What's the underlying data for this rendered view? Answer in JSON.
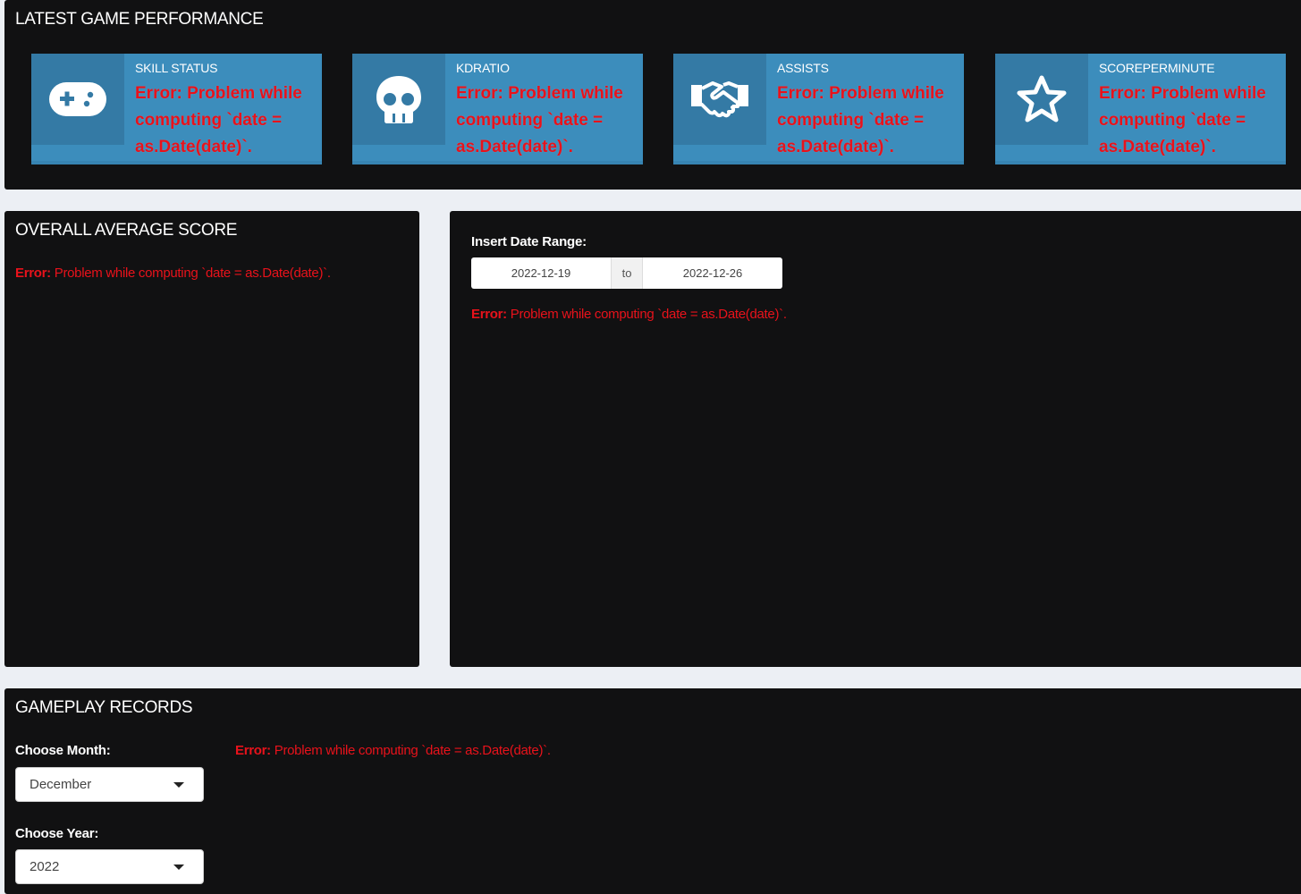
{
  "top_panel": {
    "title": "LATEST GAME PERFORMANCE",
    "boxes": [
      {
        "label": "SKILL STATUS",
        "error": "Error: Problem while computing `date = as.Date(date)`.",
        "icon": "gamepad-icon"
      },
      {
        "label": "KDRATIO",
        "error": "Error: Problem while computing `date = as.Date(date)`.",
        "icon": "skull-icon"
      },
      {
        "label": "ASSISTS",
        "error": "Error: Problem while computing `date = as.Date(date)`.",
        "icon": "handshake-icon"
      },
      {
        "label": "SCOREPERMINUTE",
        "error": "Error: Problem while computing `date = as.Date(date)`.",
        "icon": "star-icon"
      }
    ]
  },
  "average_panel": {
    "title": "OVERALL AVERAGE SCORE",
    "error_prefix": "Error:",
    "error_text": " Problem while computing `date = as.Date(date)`."
  },
  "range_panel": {
    "label": "Insert Date Range:",
    "start_date": "2022-12-19",
    "separator": "to",
    "end_date": "2022-12-26",
    "error_prefix": "Error:",
    "error_text": " Problem while computing `date = as.Date(date)`."
  },
  "records_panel": {
    "title": "GAMEPLAY RECORDS",
    "month_label": "Choose Month:",
    "month_value": "December",
    "year_label": "Choose Year:",
    "year_value": "2022",
    "error_prefix": "Error:",
    "error_text": " Problem while computing `date = as.Date(date)`."
  },
  "colors": {
    "panel_bg": "#111112",
    "page_bg": "#eceff4",
    "infobox_bg": "#3c8dbc",
    "infobox_icon_bg": "#347aa5",
    "error": "#e8121b"
  }
}
